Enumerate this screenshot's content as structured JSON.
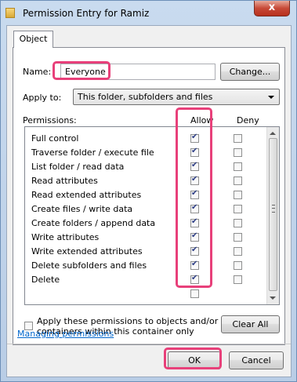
{
  "window": {
    "title": "Permission Entry for Ramiz",
    "close_glyph": "x"
  },
  "tabs": [
    {
      "label": "Object"
    }
  ],
  "name_field": {
    "label": "Name:",
    "value": "Everyone",
    "change_button": "Change..."
  },
  "apply_to": {
    "label": "Apply to:",
    "value": "This folder, subfolders and files"
  },
  "permissions": {
    "label": "Permissions:",
    "allow_header": "Allow",
    "deny_header": "Deny",
    "rows": [
      {
        "label": "Full control",
        "allow": true,
        "deny": false
      },
      {
        "label": "Traverse folder / execute file",
        "allow": true,
        "deny": false
      },
      {
        "label": "List folder / read data",
        "allow": true,
        "deny": false
      },
      {
        "label": "Read attributes",
        "allow": true,
        "deny": false
      },
      {
        "label": "Read extended attributes",
        "allow": true,
        "deny": false
      },
      {
        "label": "Create files / write data",
        "allow": true,
        "deny": false
      },
      {
        "label": "Create folders / append data",
        "allow": true,
        "deny": false
      },
      {
        "label": "Write attributes",
        "allow": true,
        "deny": false
      },
      {
        "label": "Write extended attributes",
        "allow": true,
        "deny": false
      },
      {
        "label": "Delete subfolders and files",
        "allow": true,
        "deny": false
      },
      {
        "label": "Delete",
        "allow": true,
        "deny": false
      }
    ]
  },
  "apply_within": {
    "label_line1": "Apply these permissions to objects and/or",
    "label_line2": "containers within this container only",
    "checked": false
  },
  "clear_all_button": "Clear All",
  "managing_link": "Managing permissions",
  "ok_button": "OK",
  "cancel_button": "Cancel",
  "colors": {
    "highlight": "#e8407a",
    "link": "#0066cc"
  }
}
